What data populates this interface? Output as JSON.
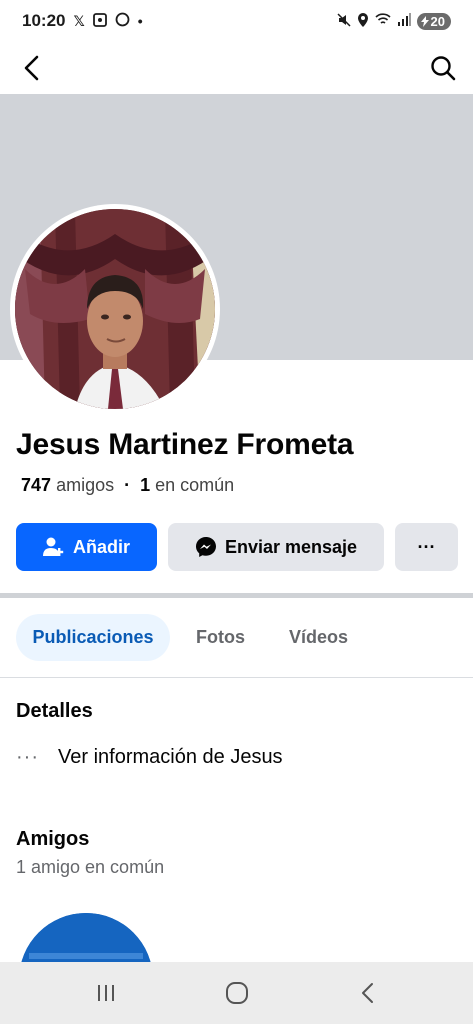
{
  "status_bar": {
    "time": "10:20",
    "battery": "20"
  },
  "profile": {
    "name": "Jesus Martinez Frometa",
    "friends_count": "747",
    "friends_label": "amigos",
    "mutual_count": "1",
    "mutual_label": "en común"
  },
  "actions": {
    "add_label": "Añadir",
    "message_label": "Enviar mensaje",
    "more_label": "···"
  },
  "tabs": [
    {
      "label": "Publicaciones",
      "active": true
    },
    {
      "label": "Fotos",
      "active": false
    },
    {
      "label": "Vídeos",
      "active": false
    }
  ],
  "details": {
    "title": "Detalles",
    "item_label": "Ver información de Jesus"
  },
  "friends_section": {
    "title": "Amigos",
    "subtitle": "1 amigo en común"
  },
  "colors": {
    "primary": "#0866ff",
    "cover": "#d0d3d8",
    "secondary_button": "#e4e6eb",
    "active_tab_bg": "#ebf5ff",
    "active_tab_text": "#0a5bb5"
  }
}
